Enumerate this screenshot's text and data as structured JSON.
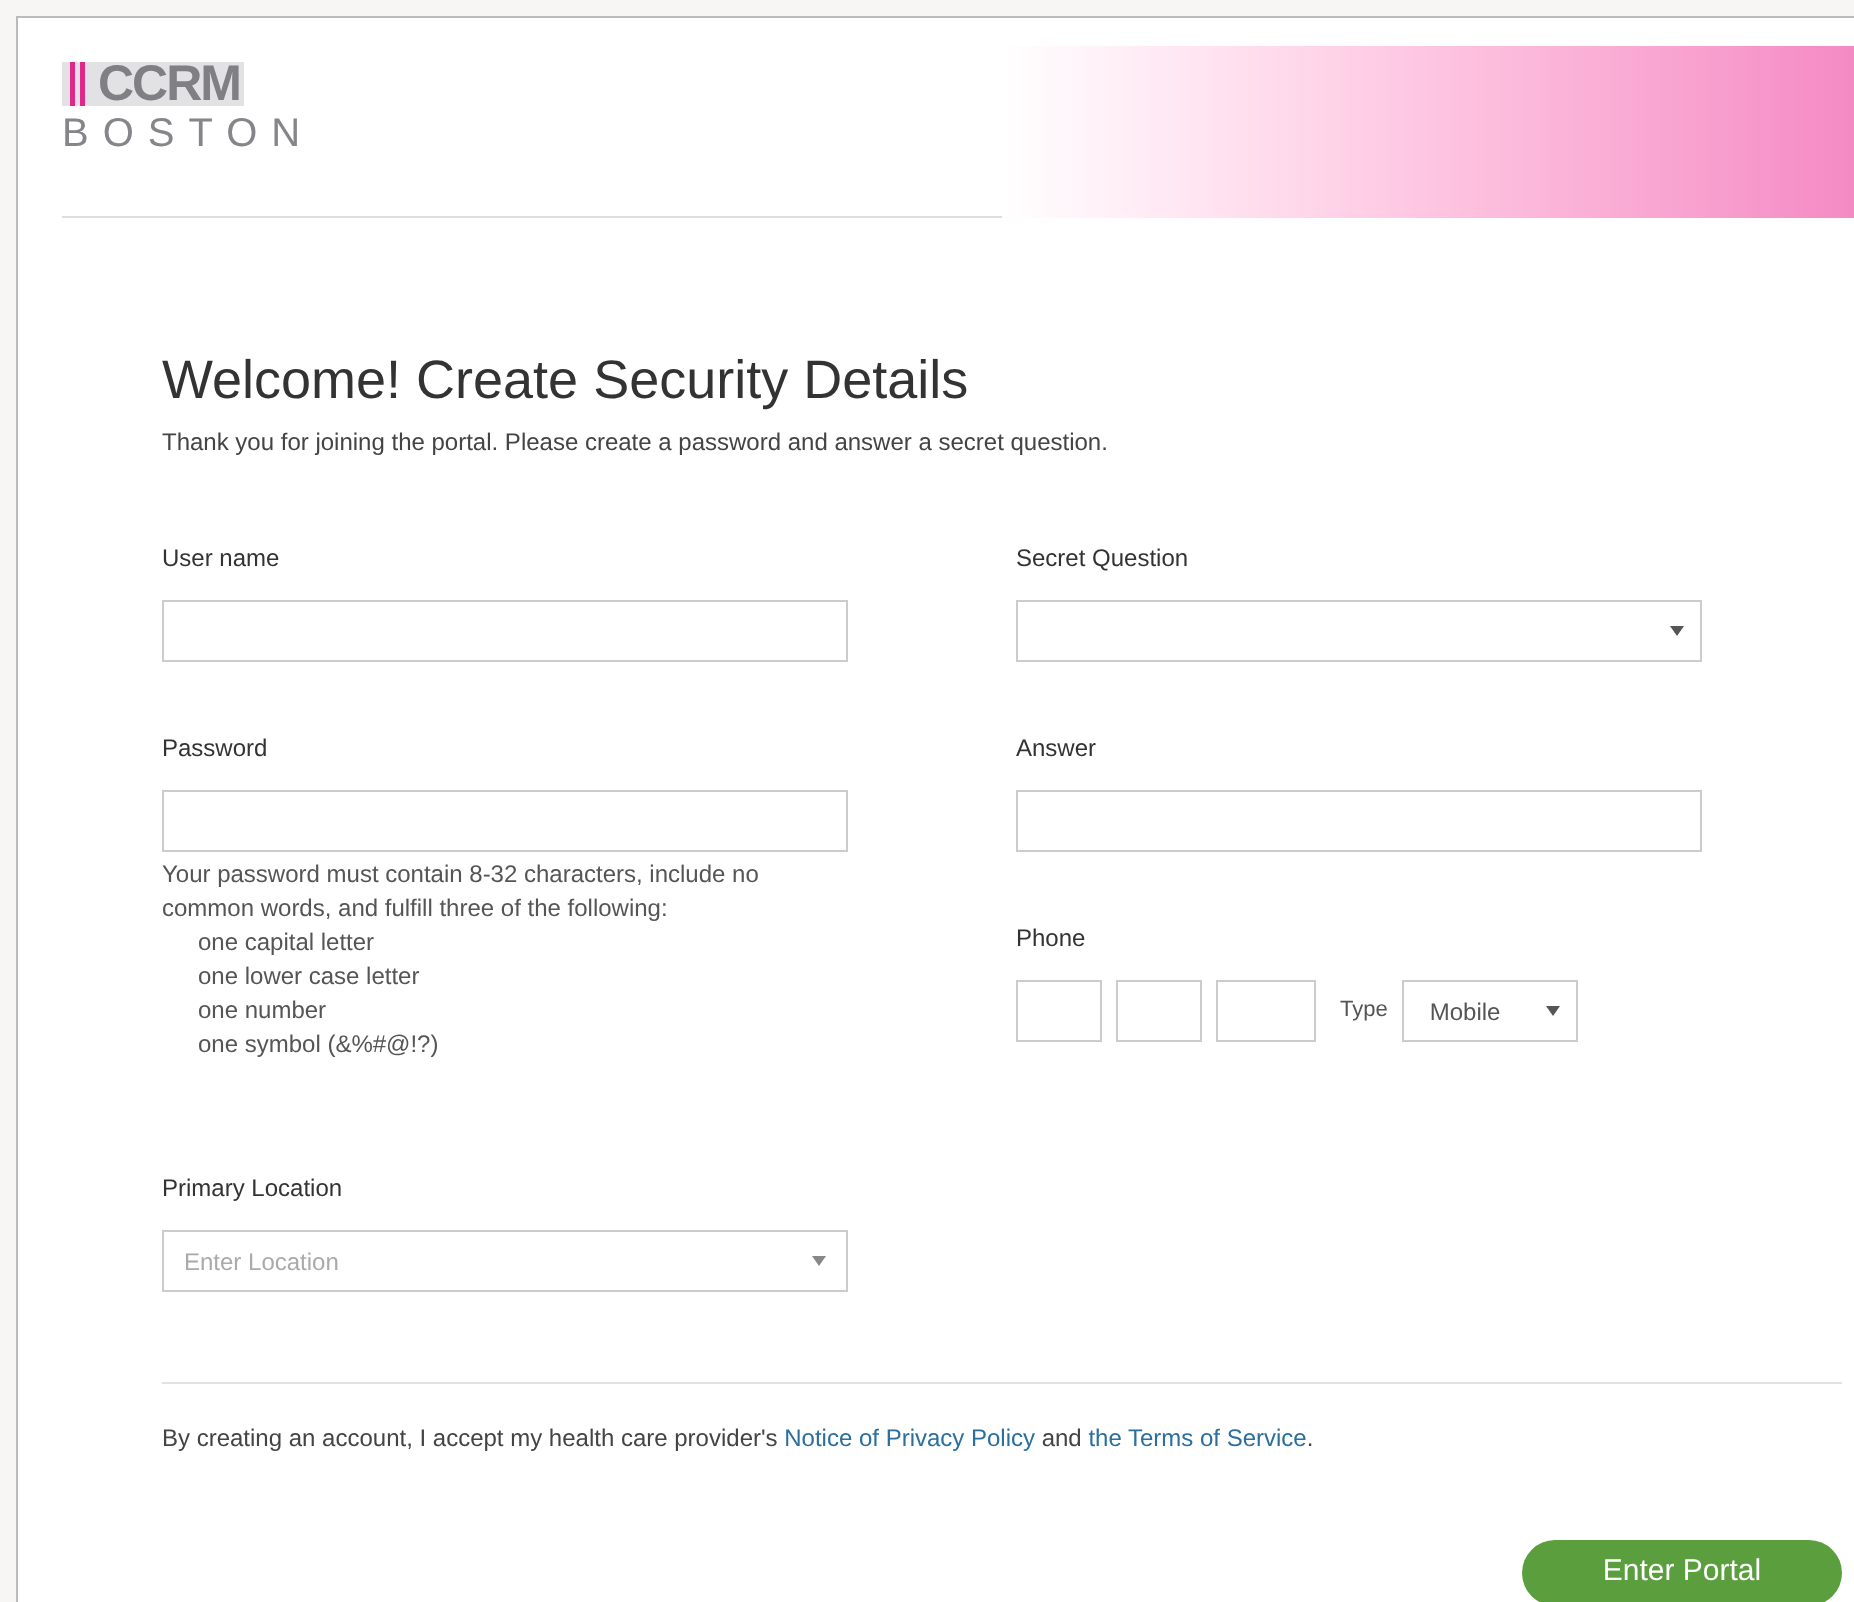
{
  "logo": {
    "mark": "CCRM",
    "city": "BOSTON"
  },
  "heading": {
    "title": "Welcome! Create Security Details",
    "subtitle": "Thank you for joining the portal. Please create a password and answer a secret question."
  },
  "form": {
    "username": {
      "label": "User name"
    },
    "secret_question": {
      "label": "Secret Question"
    },
    "password": {
      "label": "Password",
      "hint_lines": [
        "Your password must contain 8-32 characters, include no common words, and fulfill three of the following:"
      ],
      "rules": [
        "one capital letter",
        "one lower case letter",
        "one number",
        "one symbol (&%#@!?)"
      ]
    },
    "answer": {
      "label": "Answer"
    },
    "phone": {
      "label": "Phone",
      "type_label": "Type",
      "type_value": "Mobile"
    },
    "primary_location": {
      "label": "Primary Location",
      "placeholder": "Enter Location"
    }
  },
  "legal": {
    "before": "By creating an account, I accept my health care provider's ",
    "link_1": "Notice of Privacy Policy",
    "middle": " and ",
    "link_2": "the Terms of Service",
    "after": "."
  },
  "submit": "Enter Portal"
}
